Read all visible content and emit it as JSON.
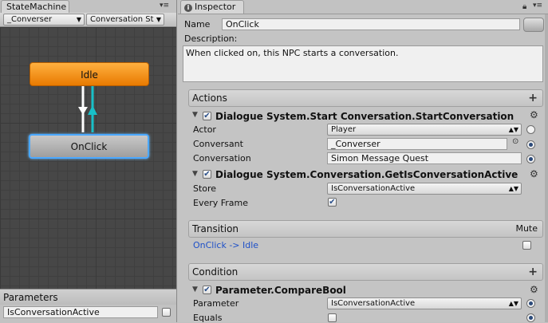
{
  "left_panel": {
    "tab_title": "StateMachine",
    "dropdowns": [
      "_Converser",
      "Conversation St"
    ],
    "nodes": {
      "idle": "Idle",
      "onclick": "OnClick"
    },
    "parameters": {
      "title": "Parameters",
      "item_name": "IsConversationActive"
    }
  },
  "inspector": {
    "tab_title": "Inspector",
    "name_label": "Name",
    "name_value": "OnClick",
    "description_label": "Description:",
    "description_value": "When clicked on, this NPC starts a conversation.",
    "actions": {
      "title": "Actions",
      "action1": {
        "title": "Dialogue System.Start Conversation.StartConversation",
        "actor_label": "Actor",
        "actor_value": "Player",
        "conversant_label": "Conversant",
        "conversant_value": "_Converser",
        "conversation_label": "Conversation",
        "conversation_value": "Simon Message Quest"
      },
      "action2": {
        "title": "Dialogue System.Conversation.GetIsConversationActive",
        "store_label": "Store",
        "store_value": "IsConversationActive",
        "every_frame_label": "Every Frame"
      }
    },
    "transition": {
      "title": "Transition",
      "mute_label": "Mute",
      "item": "OnClick -> Idle"
    },
    "condition": {
      "title": "Condition",
      "item_title": "Parameter.CompareBool",
      "parameter_label": "Parameter",
      "parameter_value": "IsConversationActive",
      "equals_label": "Equals"
    }
  },
  "colors": {
    "accent_link": "#1e50c8",
    "transition_cyan": "#18c0c8",
    "idle_orange": "#f08c10"
  }
}
